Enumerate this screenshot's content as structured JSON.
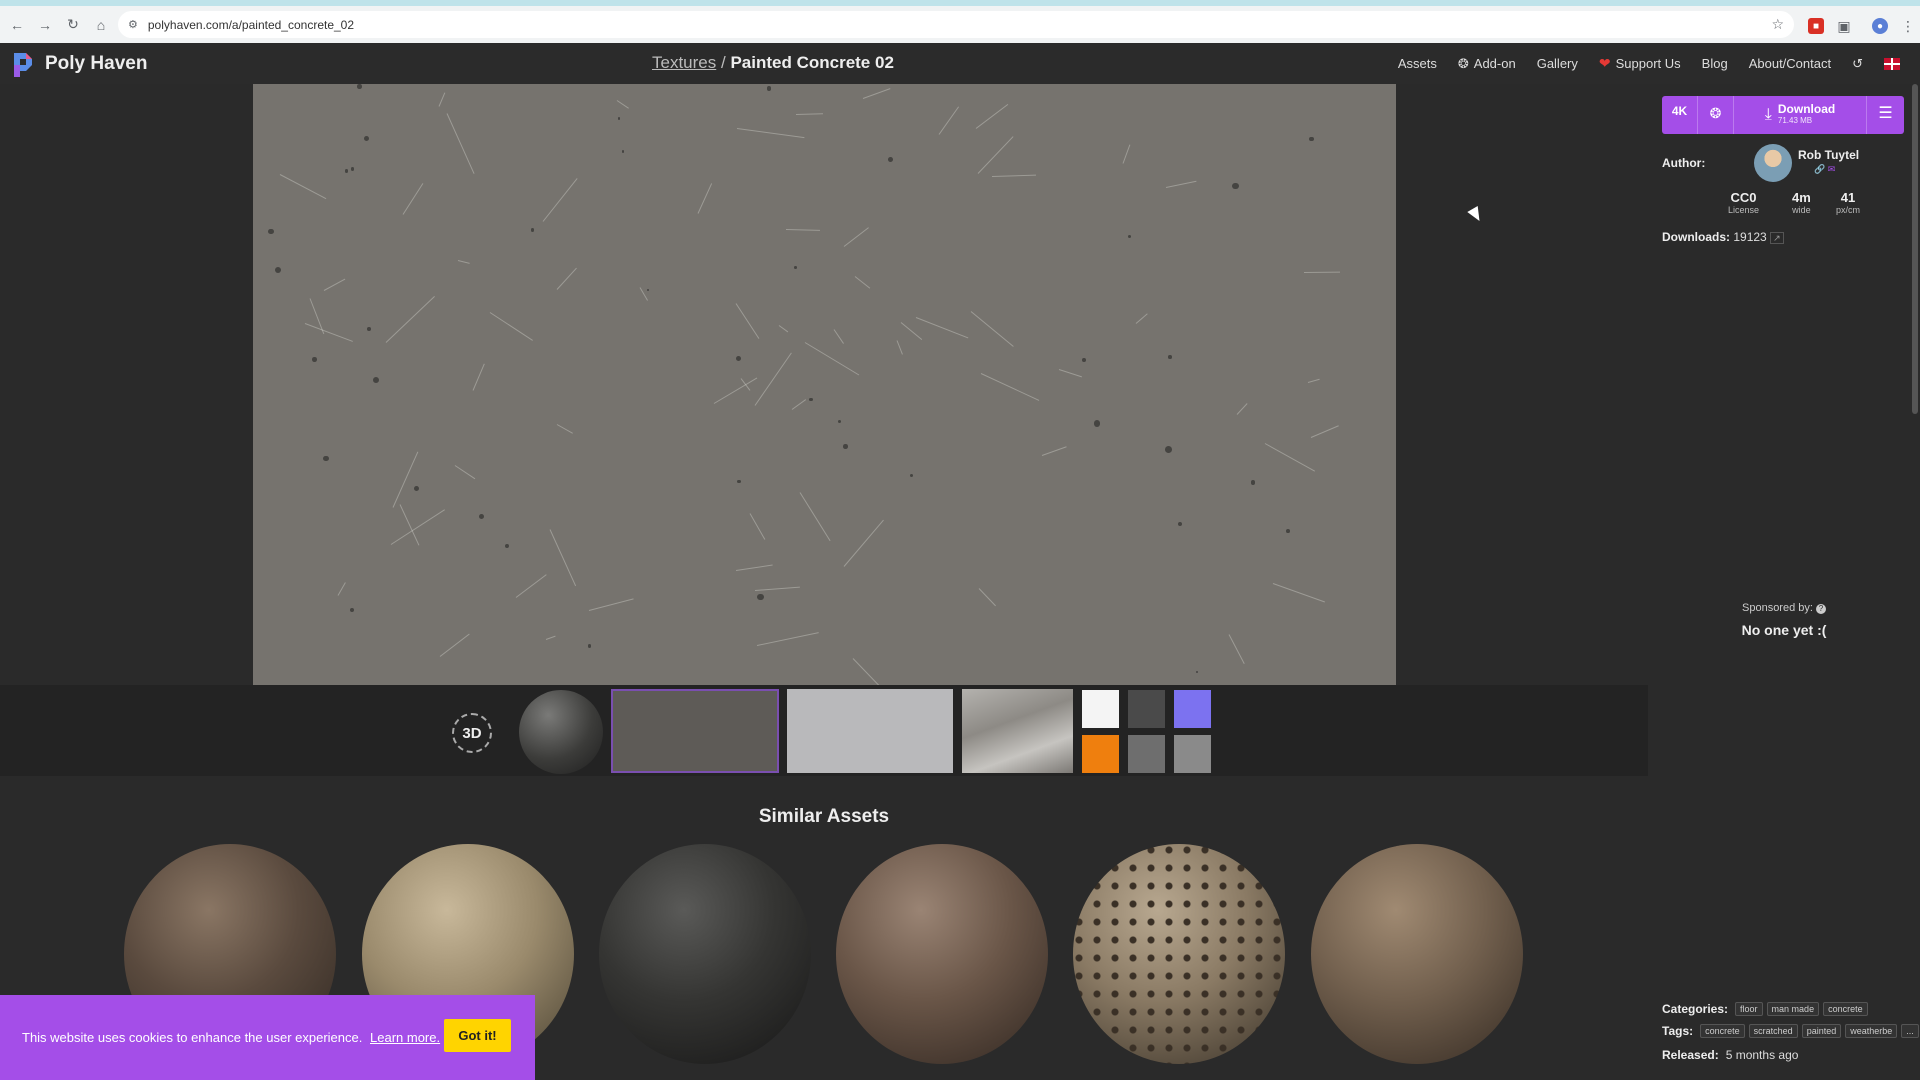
{
  "browser": {
    "url": "polyhaven.com/a/painted_concrete_02"
  },
  "header": {
    "brand": "Poly Haven",
    "breadcrumb_parent": "Textures",
    "breadcrumb_sep": "/",
    "breadcrumb_current": "Painted Concrete 02",
    "nav": {
      "assets": "Assets",
      "addon": "Add-on",
      "gallery": "Gallery",
      "support": "Support Us",
      "blog": "Blog",
      "about": "About/Contact"
    }
  },
  "viewer": {
    "btn_3d": "3D"
  },
  "swatches": [
    "#f4f4f4",
    "#4a4a4a",
    "#7c72f0",
    "#ef7f0e",
    "#6e6e6e",
    "#8a8a8a"
  ],
  "similar": {
    "title": "Similar Assets"
  },
  "sidebar": {
    "resolution": "4K",
    "download_label": "Download",
    "download_size": "71.43 MB",
    "author_label": "Author:",
    "author_name": "Rob Tuytel",
    "stats": [
      {
        "value": "CC0",
        "label": "License"
      },
      {
        "value": "4m",
        "label": "wide"
      },
      {
        "value": "41",
        "label": "px/cm"
      }
    ],
    "downloads_label": "Downloads:",
    "downloads_value": "19123",
    "sponsored_label": "Sponsored by:",
    "sponsored_value": "No one yet :(",
    "categories_label": "Categories:",
    "categories": [
      "floor",
      "man made",
      "concrete"
    ],
    "tags_label": "Tags:",
    "tags": [
      "concrete",
      "scratched",
      "painted",
      "weatherbe"
    ],
    "tags_more": "...",
    "released_label": "Released:",
    "released_value": "5 months ago"
  },
  "cookie": {
    "message": "This website uses cookies to enhance the user experience.",
    "learn_more": "Learn more.",
    "accept": "Got it!"
  },
  "colors": {
    "accent": "#a44ee8",
    "cookie_button": "#ffd400"
  }
}
